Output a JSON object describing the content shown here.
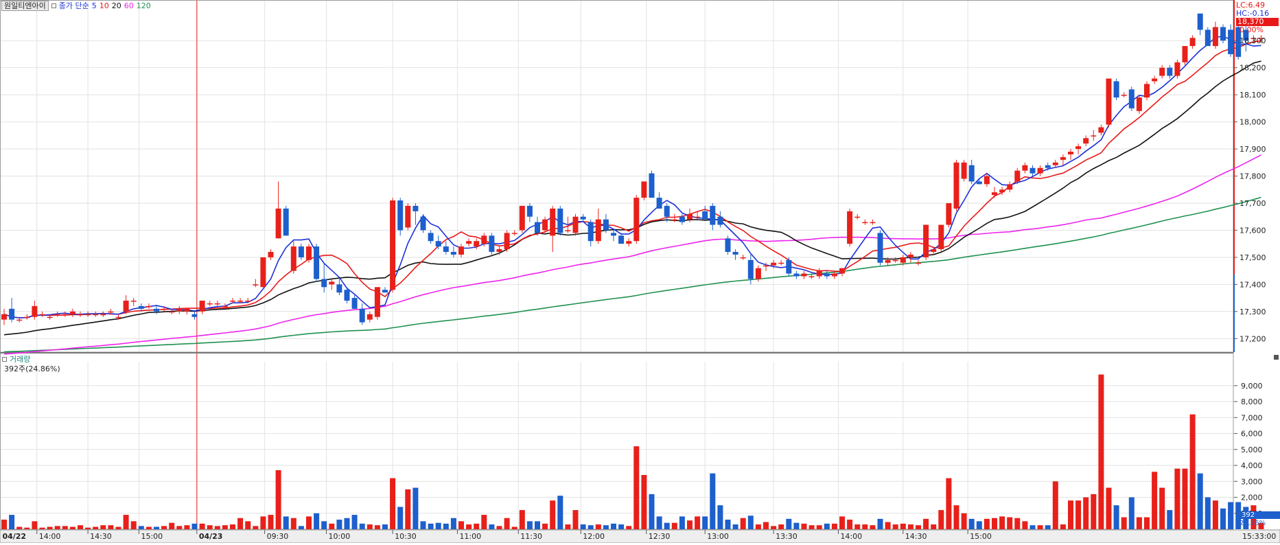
{
  "header": {
    "stock_name": "원일티엔아이",
    "ma_label": "종가 단순",
    "ma_periods": [
      "5",
      "10",
      "20",
      "60",
      "120"
    ],
    "ma_colors": [
      "#1a30d8",
      "#e81818",
      "#111111",
      "#ee22ee",
      "#1f9050"
    ]
  },
  "right_info": {
    "lc": "LC:6.49",
    "hc": "HC:-0.16",
    "price_tag": "18,370",
    "pct": "0.00%"
  },
  "volume_panel": {
    "title": "거래량",
    "info": "392주(24.86%)",
    "value_tag": "392",
    "pct_tag": "24.86%"
  },
  "time_labels": [
    "04/22",
    "14:00",
    "14:30",
    "15:00",
    "04/23",
    "09:30",
    "10:00",
    "10:30",
    "11:00",
    "11:30",
    "12:00",
    "12:30",
    "13:00",
    "13:30",
    "14:00",
    "14:30",
    "15:00",
    "15:33:00"
  ],
  "chart_data": {
    "type": "candlestick",
    "price_axis": {
      "ylim": [
        17150,
        18450
      ],
      "ticks": [
        "17,200",
        "17,300",
        "17,400",
        "17,500",
        "17,600",
        "17,700",
        "17,800",
        "17,900",
        "18,000",
        "18,100",
        "18,200",
        "18,300"
      ],
      "tick_values": [
        17200,
        17300,
        17400,
        17500,
        17600,
        17700,
        17800,
        17900,
        18000,
        18100,
        18200,
        18300
      ]
    },
    "volume_axis": {
      "ylim": [
        0,
        10500
      ],
      "ticks": [
        "1,000",
        "2,000",
        "3,000",
        "4,000",
        "5,000",
        "6,000",
        "7,000",
        "8,000",
        "9,000"
      ],
      "tick_values": [
        1000,
        2000,
        3000,
        4000,
        5000,
        6000,
        7000,
        8000,
        9000
      ]
    },
    "grid": true,
    "up_color": "#e8201a",
    "down_color": "#1d5fcc",
    "candles": [
      [
        17270,
        17310,
        17250,
        17290,
        600
      ],
      [
        17310,
        17350,
        17260,
        17270,
        900
      ],
      [
        17270,
        17280,
        17260,
        17270,
        150
      ],
      [
        17280,
        17290,
        17270,
        17280,
        100
      ],
      [
        17280,
        17340,
        17270,
        17320,
        500
      ],
      [
        17290,
        17300,
        17280,
        17290,
        100
      ],
      [
        17280,
        17290,
        17270,
        17280,
        150
      ],
      [
        17290,
        17300,
        17280,
        17290,
        200
      ],
      [
        17290,
        17300,
        17280,
        17290,
        200
      ],
      [
        17290,
        17310,
        17280,
        17300,
        150
      ],
      [
        17290,
        17300,
        17280,
        17290,
        250
      ],
      [
        17290,
        17300,
        17280,
        17290,
        100
      ],
      [
        17290,
        17300,
        17280,
        17290,
        150
      ],
      [
        17290,
        17300,
        17280,
        17290,
        250
      ],
      [
        17300,
        17310,
        17290,
        17300,
        250
      ],
      [
        17280,
        17290,
        17270,
        17280,
        150
      ],
      [
        17300,
        17360,
        17290,
        17340,
        900
      ],
      [
        17340,
        17350,
        17320,
        17340,
        500
      ],
      [
        17320,
        17330,
        17300,
        17310,
        200
      ],
      [
        17320,
        17330,
        17310,
        17320,
        150
      ],
      [
        17310,
        17320,
        17290,
        17300,
        150
      ],
      [
        17310,
        17320,
        17300,
        17310,
        200
      ],
      [
        17300,
        17310,
        17290,
        17300,
        400
      ],
      [
        17300,
        17320,
        17290,
        17310,
        200
      ],
      [
        17300,
        17310,
        17290,
        17310,
        250
      ],
      [
        17290,
        17300,
        17270,
        17280,
        350
      ],
      [
        17300,
        17340,
        17290,
        17340,
        350
      ],
      [
        17330,
        17340,
        17320,
        17330,
        250
      ],
      [
        17330,
        17340,
        17320,
        17330,
        200
      ],
      [
        17320,
        17330,
        17310,
        17320,
        250
      ],
      [
        17340,
        17350,
        17330,
        17340,
        300
      ],
      [
        17340,
        17350,
        17330,
        17340,
        700
      ],
      [
        17340,
        17350,
        17330,
        17340,
        500
      ],
      [
        17400,
        17420,
        17390,
        17400,
        200
      ],
      [
        17390,
        17500,
        17390,
        17500,
        800
      ],
      [
        17500,
        17530,
        17490,
        17520,
        900
      ],
      [
        17570,
        17780,
        17570,
        17680,
        3700
      ],
      [
        17680,
        17690,
        17580,
        17580,
        800
      ],
      [
        17450,
        17560,
        17440,
        17540,
        700
      ],
      [
        17540,
        17550,
        17490,
        17500,
        200
      ],
      [
        17490,
        17550,
        17480,
        17540,
        800
      ],
      [
        17540,
        17550,
        17410,
        17420,
        1000
      ],
      [
        17420,
        17480,
        17370,
        17390,
        500
      ],
      [
        17400,
        17420,
        17380,
        17410,
        350
      ],
      [
        17400,
        17420,
        17360,
        17370,
        600
      ],
      [
        17380,
        17390,
        17330,
        17340,
        700
      ],
      [
        17350,
        17360,
        17310,
        17310,
        900
      ],
      [
        17310,
        17330,
        17250,
        17260,
        350
      ],
      [
        17270,
        17300,
        17260,
        17290,
        300
      ],
      [
        17280,
        17390,
        17270,
        17390,
        250
      ],
      [
        17380,
        17390,
        17370,
        17370,
        300
      ],
      [
        17380,
        17720,
        17370,
        17710,
        3200
      ],
      [
        17710,
        17720,
        17580,
        17600,
        1400
      ],
      [
        17610,
        17700,
        17600,
        17690,
        2500
      ],
      [
        17690,
        17700,
        17620,
        17670,
        2600
      ],
      [
        17650,
        17660,
        17590,
        17600,
        500
      ],
      [
        17590,
        17600,
        17550,
        17560,
        350
      ],
      [
        17560,
        17580,
        17530,
        17540,
        400
      ],
      [
        17540,
        17560,
        17510,
        17520,
        350
      ],
      [
        17520,
        17540,
        17500,
        17510,
        700
      ],
      [
        17510,
        17550,
        17500,
        17540,
        500
      ],
      [
        17550,
        17570,
        17540,
        17560,
        300
      ],
      [
        17540,
        17570,
        17530,
        17560,
        350
      ],
      [
        17550,
        17590,
        17540,
        17580,
        900
      ],
      [
        17580,
        17590,
        17510,
        17520,
        300
      ],
      [
        17520,
        17540,
        17510,
        17530,
        200
      ],
      [
        17530,
        17600,
        17520,
        17590,
        700
      ],
      [
        17590,
        17600,
        17580,
        17590,
        150
      ],
      [
        17600,
        17690,
        17590,
        17690,
        1200
      ],
      [
        17690,
        17700,
        17630,
        17650,
        500
      ],
      [
        17630,
        17650,
        17580,
        17590,
        500
      ],
      [
        17600,
        17650,
        17590,
        17640,
        350
      ],
      [
        17580,
        17690,
        17520,
        17680,
        1800
      ],
      [
        17680,
        17690,
        17580,
        17590,
        2100
      ],
      [
        17600,
        17650,
        17590,
        17600,
        300
      ],
      [
        17590,
        17660,
        17580,
        17650,
        1200
      ],
      [
        17650,
        17660,
        17630,
        17640,
        300
      ],
      [
        17630,
        17640,
        17540,
        17560,
        250
      ],
      [
        17560,
        17680,
        17550,
        17640,
        300
      ],
      [
        17640,
        17660,
        17590,
        17600,
        250
      ],
      [
        17590,
        17600,
        17560,
        17580,
        350
      ],
      [
        17580,
        17590,
        17550,
        17550,
        300
      ],
      [
        17550,
        17570,
        17540,
        17560,
        200
      ],
      [
        17560,
        17730,
        17550,
        17720,
        5200
      ],
      [
        17720,
        17780,
        17710,
        17780,
        3400
      ],
      [
        17810,
        17820,
        17720,
        17720,
        2200
      ],
      [
        17720,
        17740,
        17680,
        17680,
        800
      ],
      [
        17690,
        17700,
        17630,
        17650,
        400
      ],
      [
        17640,
        17660,
        17630,
        17640,
        400
      ],
      [
        17650,
        17660,
        17620,
        17630,
        800
      ],
      [
        17640,
        17680,
        17630,
        17660,
        550
      ],
      [
        17650,
        17670,
        17640,
        17650,
        800
      ],
      [
        17670,
        17690,
        17640,
        17640,
        800
      ],
      [
        17690,
        17700,
        17600,
        17620,
        3500
      ],
      [
        17650,
        17670,
        17610,
        17620,
        1500
      ],
      [
        17570,
        17580,
        17510,
        17520,
        600
      ],
      [
        17520,
        17530,
        17490,
        17510,
        300
      ],
      [
        17500,
        17510,
        17490,
        17500,
        700
      ],
      [
        17490,
        17510,
        17400,
        17420,
        850
      ],
      [
        17420,
        17470,
        17410,
        17460,
        300
      ],
      [
        17470,
        17480,
        17450,
        17470,
        450
      ],
      [
        17470,
        17490,
        17460,
        17480,
        200
      ],
      [
        17480,
        17490,
        17470,
        17480,
        300
      ],
      [
        17490,
        17500,
        17430,
        17440,
        650
      ],
      [
        17440,
        17450,
        17420,
        17430,
        400
      ],
      [
        17430,
        17450,
        17420,
        17440,
        350
      ],
      [
        17430,
        17440,
        17420,
        17430,
        250
      ],
      [
        17430,
        17460,
        17420,
        17450,
        250
      ],
      [
        17440,
        17450,
        17420,
        17430,
        350
      ],
      [
        17430,
        17450,
        17420,
        17440,
        350
      ],
      [
        17440,
        17460,
        17430,
        17460,
        800
      ],
      [
        17550,
        17680,
        17540,
        17670,
        600
      ],
      [
        17650,
        17660,
        17640,
        17650,
        300
      ],
      [
        17630,
        17640,
        17620,
        17630,
        300
      ],
      [
        17630,
        17640,
        17620,
        17630,
        250
      ],
      [
        17590,
        17600,
        17470,
        17480,
        650
      ],
      [
        17480,
        17500,
        17470,
        17490,
        450
      ],
      [
        17490,
        17500,
        17480,
        17490,
        300
      ],
      [
        17480,
        17510,
        17470,
        17500,
        350
      ],
      [
        17500,
        17520,
        17480,
        17510,
        300
      ],
      [
        17480,
        17490,
        17470,
        17480,
        250
      ],
      [
        17500,
        17620,
        17490,
        17620,
        650
      ],
      [
        17520,
        17540,
        17510,
        17530,
        300
      ],
      [
        17530,
        17620,
        17520,
        17620,
        1200
      ],
      [
        17620,
        17700,
        17610,
        17700,
        3200
      ],
      [
        17680,
        17860,
        17670,
        17850,
        1500
      ],
      [
        17790,
        17860,
        17780,
        17850,
        1000
      ],
      [
        17840,
        17860,
        17770,
        17780,
        650
      ],
      [
        17780,
        17790,
        17770,
        17770,
        500
      ],
      [
        17770,
        17810,
        17760,
        17800,
        650
      ],
      [
        17730,
        17760,
        17720,
        17740,
        700
      ],
      [
        17740,
        17760,
        17730,
        17750,
        800
      ],
      [
        17750,
        17780,
        17740,
        17770,
        750
      ],
      [
        17780,
        17830,
        17770,
        17820,
        700
      ],
      [
        17820,
        17850,
        17810,
        17840,
        500
      ],
      [
        17830,
        17840,
        17800,
        17810,
        250
      ],
      [
        17810,
        17840,
        17800,
        17830,
        250
      ],
      [
        17840,
        17850,
        17820,
        17830,
        250
      ],
      [
        17840,
        17860,
        17830,
        17850,
        3000
      ],
      [
        17860,
        17880,
        17840,
        17870,
        300
      ],
      [
        17880,
        17900,
        17860,
        17890,
        1800
      ],
      [
        17900,
        17920,
        17880,
        17910,
        1800
      ],
      [
        17920,
        17950,
        17910,
        17940,
        2000
      ],
      [
        17950,
        17970,
        17930,
        17950,
        2200
      ],
      [
        17960,
        17990,
        17950,
        17980,
        9700
      ],
      [
        17990,
        18160,
        17980,
        18160,
        2600
      ],
      [
        18150,
        18160,
        18080,
        18090,
        1500
      ],
      [
        18100,
        18110,
        18090,
        18100,
        750
      ],
      [
        18120,
        18130,
        18040,
        18050,
        2000
      ],
      [
        18040,
        18100,
        18030,
        18090,
        750
      ],
      [
        18090,
        18150,
        18080,
        18140,
        750
      ],
      [
        18150,
        18170,
        18140,
        18160,
        3600
      ],
      [
        18170,
        18210,
        18160,
        18200,
        2600
      ],
      [
        18200,
        18210,
        18160,
        18170,
        1200
      ],
      [
        18170,
        18230,
        18160,
        18220,
        3800
      ],
      [
        18220,
        18280,
        18210,
        18280,
        3800
      ],
      [
        18280,
        18320,
        18270,
        18310,
        7200
      ],
      [
        18400,
        18400,
        18320,
        18340,
        3500
      ],
      [
        18340,
        18350,
        18280,
        18280,
        2000
      ],
      [
        18280,
        18370,
        18270,
        18350,
        1800
      ],
      [
        18350,
        18360,
        18290,
        18300,
        1300
      ],
      [
        18340,
        18360,
        18240,
        18250,
        1700
      ],
      [
        18350,
        18370,
        18230,
        18240,
        1700
      ],
      [
        18340,
        18360,
        18260,
        18300,
        1400
      ],
      [
        18310,
        18320,
        18290,
        18310,
        1500
      ],
      [
        18310,
        18320,
        18290,
        18310,
        392
      ]
    ]
  }
}
